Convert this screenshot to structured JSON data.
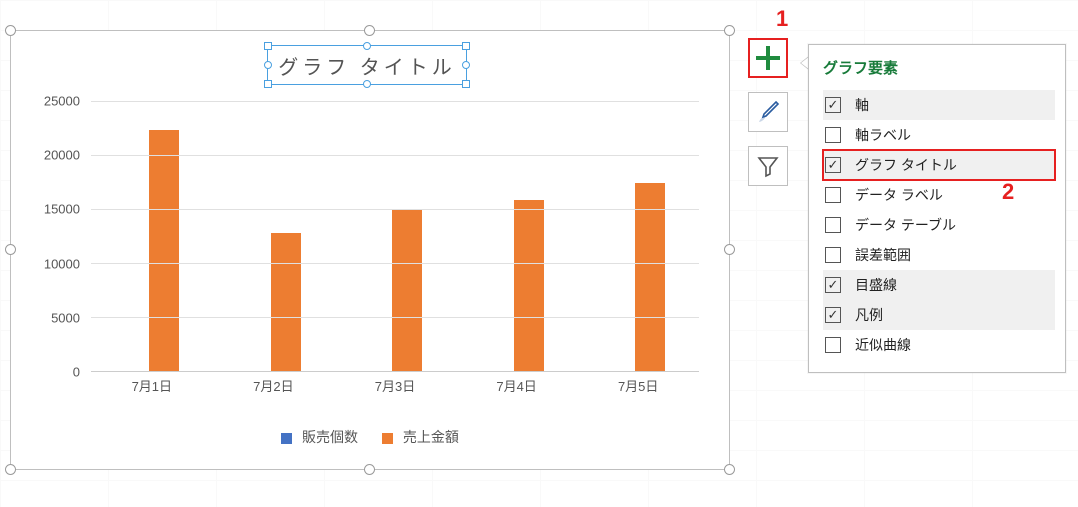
{
  "chart_data": {
    "type": "bar",
    "title": "グラフ タイトル",
    "categories": [
      "7月1日",
      "7月2日",
      "7月3日",
      "7月4日",
      "7月5日"
    ],
    "series": [
      {
        "name": "販売個数",
        "color": "#4472C4",
        "values": [
          null,
          null,
          null,
          null,
          null
        ]
      },
      {
        "name": "売上金額",
        "color": "#ED7D31",
        "values": [
          22300,
          12800,
          14900,
          15800,
          17400
        ]
      }
    ],
    "xlabel": "",
    "ylabel": "",
    "ylim": [
      0,
      25000
    ],
    "ytick_step": 5000,
    "yticks": [
      "0",
      "5000",
      "10000",
      "15000",
      "20000",
      "25000"
    ]
  },
  "side_buttons": {
    "plus": "add-chart-element",
    "brush": "chart-styles",
    "funnel": "chart-filters"
  },
  "popup": {
    "title": "グラフ要素",
    "items": [
      {
        "label": "軸",
        "checked": true,
        "shaded": true
      },
      {
        "label": "軸ラベル",
        "checked": false,
        "shaded": false
      },
      {
        "label": "グラフ タイトル",
        "checked": true,
        "shaded": true,
        "highlight": true
      },
      {
        "label": "データ ラベル",
        "checked": false,
        "shaded": false
      },
      {
        "label": "データ テーブル",
        "checked": false,
        "shaded": false
      },
      {
        "label": "誤差範囲",
        "checked": false,
        "shaded": false
      },
      {
        "label": "目盛線",
        "checked": true,
        "shaded": true
      },
      {
        "label": "凡例",
        "checked": true,
        "shaded": true
      },
      {
        "label": "近似曲線",
        "checked": false,
        "shaded": false
      }
    ]
  },
  "callouts": {
    "one": "1",
    "two": "2"
  }
}
